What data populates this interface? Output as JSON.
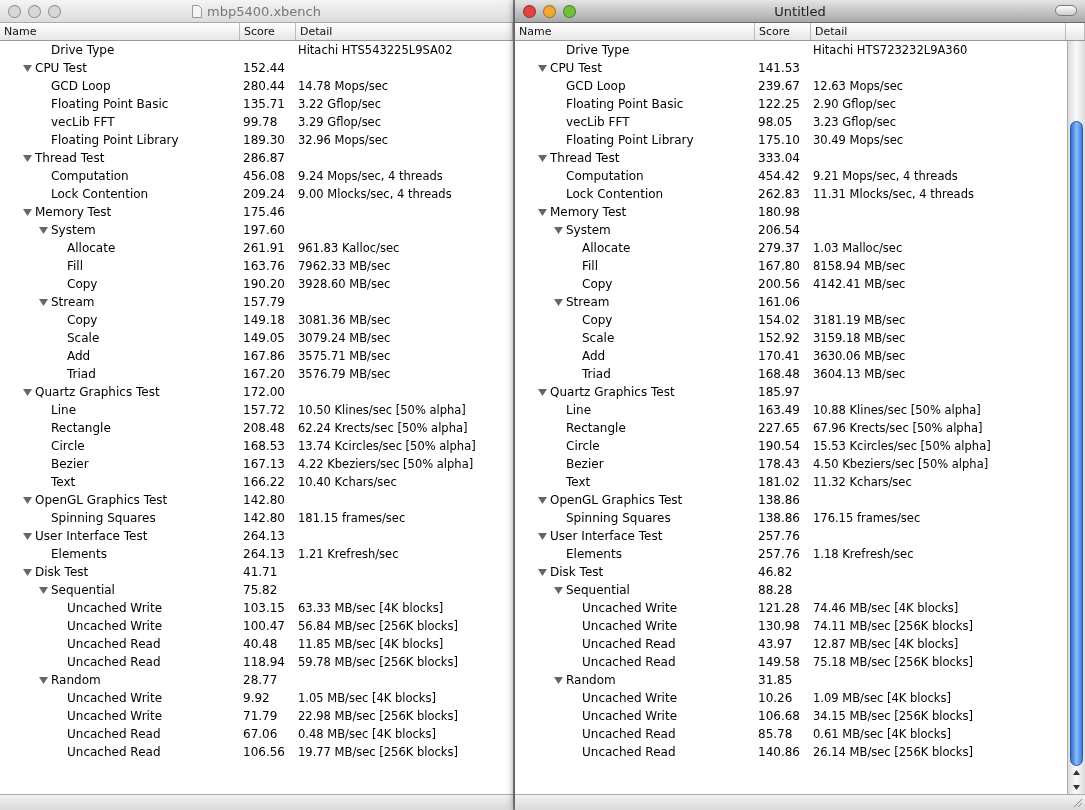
{
  "windows": [
    {
      "title": "mbp5400.xbench",
      "active": false,
      "saved": true,
      "columns": [
        "Name",
        "Score",
        "Detail"
      ],
      "clipped_rows": [
        {
          "name": "Drive Type",
          "detail": "Hitachi HTS543225L9SA02"
        }
      ],
      "rows": [
        {
          "name": "CPU Test",
          "score": "152.44",
          "expanded": true,
          "children": [
            {
              "name": "GCD Loop",
              "score": "280.44",
              "detail": "14.78 Mops/sec"
            },
            {
              "name": "Floating Point Basic",
              "score": "135.71",
              "detail": "3.22 Gflop/sec"
            },
            {
              "name": "vecLib FFT",
              "score": "99.78",
              "detail": "3.29 Gflop/sec"
            },
            {
              "name": "Floating Point Library",
              "score": "189.30",
              "detail": "32.96 Mops/sec"
            }
          ]
        },
        {
          "name": "Thread Test",
          "score": "286.87",
          "expanded": true,
          "children": [
            {
              "name": "Computation",
              "score": "456.08",
              "detail": "9.24 Mops/sec, 4 threads"
            },
            {
              "name": "Lock Contention",
              "score": "209.24",
              "detail": "9.00 Mlocks/sec, 4 threads"
            }
          ]
        },
        {
          "name": "Memory Test",
          "score": "175.46",
          "expanded": true,
          "children": [
            {
              "name": "System",
              "score": "197.60",
              "expanded": true,
              "children": [
                {
                  "name": "Allocate",
                  "score": "261.91",
                  "detail": "961.83 Kalloc/sec"
                },
                {
                  "name": "Fill",
                  "score": "163.76",
                  "detail": "7962.33 MB/sec"
                },
                {
                  "name": "Copy",
                  "score": "190.20",
                  "detail": "3928.60 MB/sec"
                }
              ]
            },
            {
              "name": "Stream",
              "score": "157.79",
              "expanded": true,
              "children": [
                {
                  "name": "Copy",
                  "score": "149.18",
                  "detail": "3081.36 MB/sec"
                },
                {
                  "name": "Scale",
                  "score": "149.05",
                  "detail": "3079.24 MB/sec"
                },
                {
                  "name": "Add",
                  "score": "167.86",
                  "detail": "3575.71 MB/sec"
                },
                {
                  "name": "Triad",
                  "score": "167.20",
                  "detail": "3576.79 MB/sec"
                }
              ]
            }
          ]
        },
        {
          "name": "Quartz Graphics Test",
          "score": "172.00",
          "expanded": true,
          "children": [
            {
              "name": "Line",
              "score": "157.72",
              "detail": "10.50 Klines/sec [50% alpha]"
            },
            {
              "name": "Rectangle",
              "score": "208.48",
              "detail": "62.24 Krects/sec [50% alpha]"
            },
            {
              "name": "Circle",
              "score": "168.53",
              "detail": "13.74 Kcircles/sec [50% alpha]"
            },
            {
              "name": "Bezier",
              "score": "167.13",
              "detail": "4.22 Kbeziers/sec [50% alpha]"
            },
            {
              "name": "Text",
              "score": "166.22",
              "detail": "10.40 Kchars/sec"
            }
          ]
        },
        {
          "name": "OpenGL Graphics Test",
          "score": "142.80",
          "expanded": true,
          "children": [
            {
              "name": "Spinning Squares",
              "score": "142.80",
              "detail": "181.15 frames/sec"
            }
          ]
        },
        {
          "name": "User Interface Test",
          "score": "264.13",
          "expanded": true,
          "children": [
            {
              "name": "Elements",
              "score": "264.13",
              "detail": "1.21 Krefresh/sec"
            }
          ]
        },
        {
          "name": "Disk Test",
          "score": "41.71",
          "expanded": true,
          "children": [
            {
              "name": "Sequential",
              "score": "75.82",
              "expanded": true,
              "children": [
                {
                  "name": "Uncached Write",
                  "score": "103.15",
                  "detail": "63.33 MB/sec [4K blocks]"
                },
                {
                  "name": "Uncached Write",
                  "score": "100.47",
                  "detail": "56.84 MB/sec [256K blocks]"
                },
                {
                  "name": "Uncached Read",
                  "score": "40.48",
                  "detail": "11.85 MB/sec [4K blocks]"
                },
                {
                  "name": "Uncached Read",
                  "score": "118.94",
                  "detail": "59.78 MB/sec [256K blocks]"
                }
              ]
            },
            {
              "name": "Random",
              "score": "28.77",
              "expanded": true,
              "children": [
                {
                  "name": "Uncached Write",
                  "score": "9.92",
                  "detail": "1.05 MB/sec [4K blocks]"
                },
                {
                  "name": "Uncached Write",
                  "score": "71.79",
                  "detail": "22.98 MB/sec [256K blocks]"
                },
                {
                  "name": "Uncached Read",
                  "score": "67.06",
                  "detail": "0.48 MB/sec [4K blocks]"
                },
                {
                  "name": "Uncached Read",
                  "score": "106.56",
                  "detail": "19.77 MB/sec [256K blocks]"
                }
              ]
            }
          ]
        }
      ]
    },
    {
      "title": "Untitled",
      "active": true,
      "saved": false,
      "toolbar_toggle": true,
      "scrollbar": true,
      "columns": [
        "Name",
        "Score",
        "Detail"
      ],
      "clipped_rows": [
        {
          "name": "Drive Type",
          "detail": "Hitachi HTS723232L9A360"
        }
      ],
      "rows": [
        {
          "name": "CPU Test",
          "score": "141.53",
          "expanded": true,
          "children": [
            {
              "name": "GCD Loop",
              "score": "239.67",
              "detail": "12.63 Mops/sec"
            },
            {
              "name": "Floating Point Basic",
              "score": "122.25",
              "detail": "2.90 Gflop/sec"
            },
            {
              "name": "vecLib FFT",
              "score": "98.05",
              "detail": "3.23 Gflop/sec"
            },
            {
              "name": "Floating Point Library",
              "score": "175.10",
              "detail": "30.49 Mops/sec"
            }
          ]
        },
        {
          "name": "Thread Test",
          "score": "333.04",
          "expanded": true,
          "children": [
            {
              "name": "Computation",
              "score": "454.42",
              "detail": "9.21 Mops/sec, 4 threads"
            },
            {
              "name": "Lock Contention",
              "score": "262.83",
              "detail": "11.31 Mlocks/sec, 4 threads"
            }
          ]
        },
        {
          "name": "Memory Test",
          "score": "180.98",
          "expanded": true,
          "children": [
            {
              "name": "System",
              "score": "206.54",
              "expanded": true,
              "children": [
                {
                  "name": "Allocate",
                  "score": "279.37",
                  "detail": "1.03 Malloc/sec"
                },
                {
                  "name": "Fill",
                  "score": "167.80",
                  "detail": "8158.94 MB/sec"
                },
                {
                  "name": "Copy",
                  "score": "200.56",
                  "detail": "4142.41 MB/sec"
                }
              ]
            },
            {
              "name": "Stream",
              "score": "161.06",
              "expanded": true,
              "children": [
                {
                  "name": "Copy",
                  "score": "154.02",
                  "detail": "3181.19 MB/sec"
                },
                {
                  "name": "Scale",
                  "score": "152.92",
                  "detail": "3159.18 MB/sec"
                },
                {
                  "name": "Add",
                  "score": "170.41",
                  "detail": "3630.06 MB/sec"
                },
                {
                  "name": "Triad",
                  "score": "168.48",
                  "detail": "3604.13 MB/sec"
                }
              ]
            }
          ]
        },
        {
          "name": "Quartz Graphics Test",
          "score": "185.97",
          "expanded": true,
          "children": [
            {
              "name": "Line",
              "score": "163.49",
              "detail": "10.88 Klines/sec [50% alpha]"
            },
            {
              "name": "Rectangle",
              "score": "227.65",
              "detail": "67.96 Krects/sec [50% alpha]"
            },
            {
              "name": "Circle",
              "score": "190.54",
              "detail": "15.53 Kcircles/sec [50% alpha]"
            },
            {
              "name": "Bezier",
              "score": "178.43",
              "detail": "4.50 Kbeziers/sec [50% alpha]"
            },
            {
              "name": "Text",
              "score": "181.02",
              "detail": "11.32 Kchars/sec"
            }
          ]
        },
        {
          "name": "OpenGL Graphics Test",
          "score": "138.86",
          "expanded": true,
          "children": [
            {
              "name": "Spinning Squares",
              "score": "138.86",
              "detail": "176.15 frames/sec"
            }
          ]
        },
        {
          "name": "User Interface Test",
          "score": "257.76",
          "expanded": true,
          "children": [
            {
              "name": "Elements",
              "score": "257.76",
              "detail": "1.18 Krefresh/sec"
            }
          ]
        },
        {
          "name": "Disk Test",
          "score": "46.82",
          "expanded": true,
          "children": [
            {
              "name": "Sequential",
              "score": "88.28",
              "expanded": true,
              "children": [
                {
                  "name": "Uncached Write",
                  "score": "121.28",
                  "detail": "74.46 MB/sec [4K blocks]"
                },
                {
                  "name": "Uncached Write",
                  "score": "130.98",
                  "detail": "74.11 MB/sec [256K blocks]"
                },
                {
                  "name": "Uncached Read",
                  "score": "43.97",
                  "detail": "12.87 MB/sec [4K blocks]"
                },
                {
                  "name": "Uncached Read",
                  "score": "149.58",
                  "detail": "75.18 MB/sec [256K blocks]"
                }
              ]
            },
            {
              "name": "Random",
              "score": "31.85",
              "expanded": true,
              "children": [
                {
                  "name": "Uncached Write",
                  "score": "10.26",
                  "detail": "1.09 MB/sec [4K blocks]"
                },
                {
                  "name": "Uncached Write",
                  "score": "106.68",
                  "detail": "34.15 MB/sec [256K blocks]"
                },
                {
                  "name": "Uncached Read",
                  "score": "85.78",
                  "detail": "0.61 MB/sec [4K blocks]"
                },
                {
                  "name": "Uncached Read",
                  "score": "140.86",
                  "detail": "26.14 MB/sec [256K blocks]"
                }
              ]
            }
          ]
        }
      ]
    }
  ]
}
